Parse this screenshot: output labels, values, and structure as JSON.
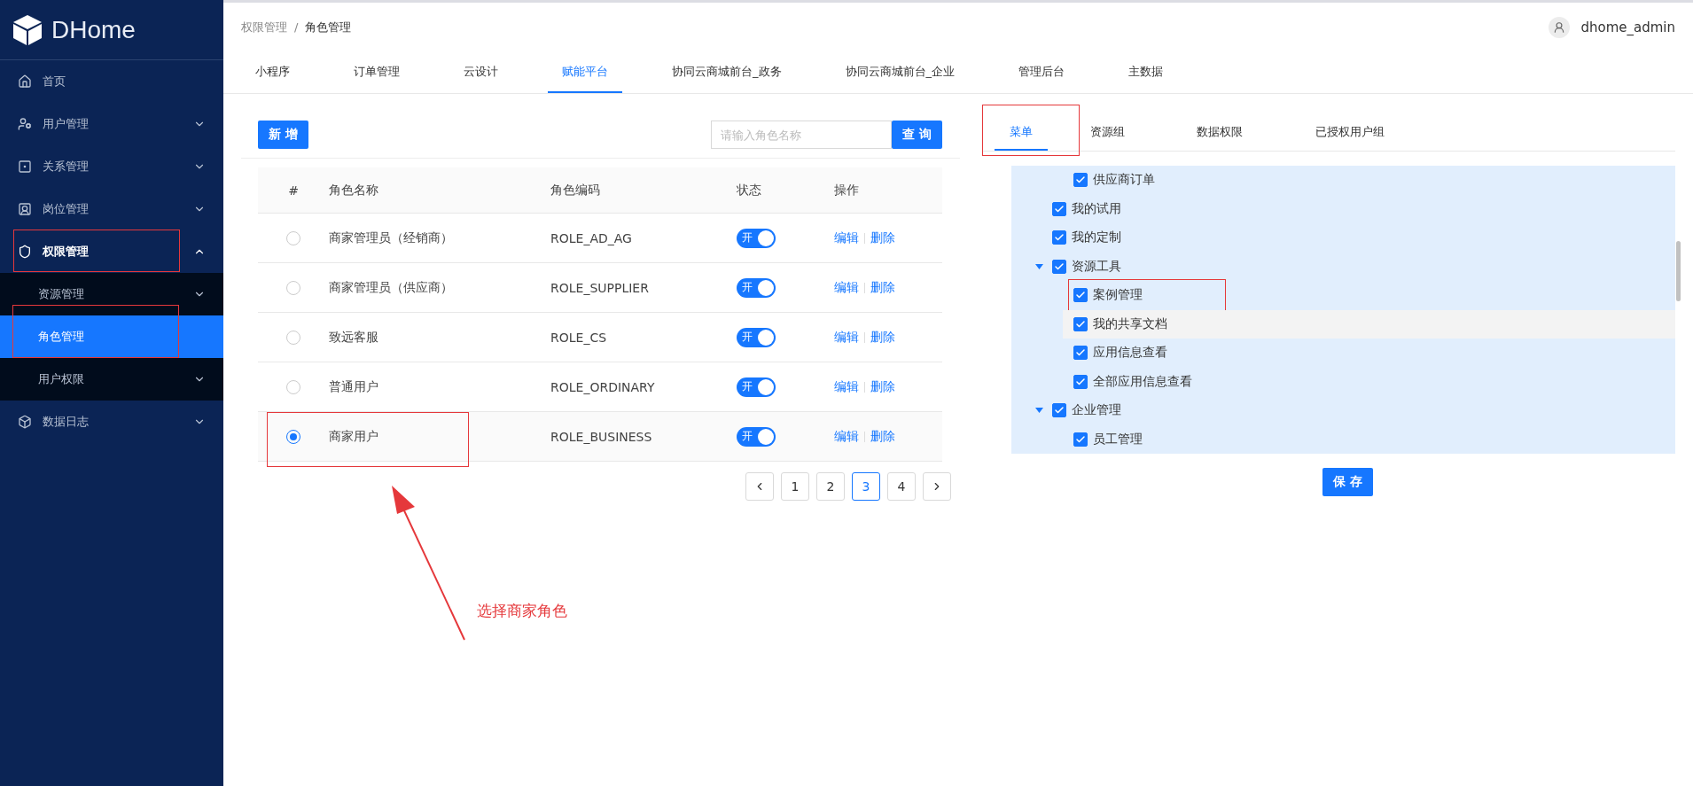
{
  "logo": {
    "text": "DHome"
  },
  "sidebar": {
    "items": [
      {
        "kind": "link",
        "label": "首页",
        "selected": false
      },
      {
        "kind": "group",
        "label": "用户管理",
        "expanded": false,
        "selected": false
      },
      {
        "kind": "group",
        "label": "关系管理",
        "expanded": false,
        "selected": false
      },
      {
        "kind": "group",
        "label": "岗位管理",
        "expanded": false,
        "selected": false
      },
      {
        "kind": "group",
        "label": "权限管理",
        "expanded": true,
        "selected": false,
        "annotated": true,
        "children": [
          {
            "kind": "group",
            "label": "资源管理",
            "expanded": false,
            "selected": false
          },
          {
            "kind": "link",
            "label": "角色管理",
            "selected": true,
            "annotated": true
          },
          {
            "kind": "group",
            "label": "用户权限",
            "expanded": false,
            "selected": false
          }
        ]
      },
      {
        "kind": "group",
        "label": "数据日志",
        "expanded": false,
        "selected": false
      }
    ]
  },
  "breadcrumb": [
    "权限管理",
    "角色管理"
  ],
  "breadcrumb_separator": "/",
  "user": {
    "name": "dhome_admin"
  },
  "top_tabs": [
    {
      "label": "小程序",
      "selected": false
    },
    {
      "label": "订单管理",
      "selected": false
    },
    {
      "label": "云设计",
      "selected": false
    },
    {
      "label": "赋能平台",
      "selected": true
    },
    {
      "label": "协同云商城前台_政务",
      "selected": false
    },
    {
      "label": "协同云商城前台_企业",
      "selected": false
    },
    {
      "label": "管理后台",
      "selected": false
    },
    {
      "label": "主数据",
      "selected": false
    }
  ],
  "toolbar": {
    "add_button": "新 增",
    "search": {
      "placeholder": "请输入角色名称"
    },
    "search_button": "查 询"
  },
  "table": {
    "columns": [
      "#",
      "角色名称",
      "角色编码",
      "状态",
      "操作"
    ],
    "rows": [
      {
        "selected": false,
        "name": "商家管理员（经销商）",
        "code": "ROLE_AD_AG",
        "status": {
          "on": true,
          "label": "开"
        },
        "actions": [
          "编辑",
          "删除"
        ]
      },
      {
        "selected": false,
        "name": "商家管理员（供应商）",
        "code": "ROLE_SUPPLIER",
        "status": {
          "on": true,
          "label": "开"
        },
        "actions": [
          "编辑",
          "删除"
        ]
      },
      {
        "selected": false,
        "name": "致远客服",
        "code": "ROLE_CS",
        "status": {
          "on": true,
          "label": "开"
        },
        "actions": [
          "编辑",
          "删除"
        ]
      },
      {
        "selected": false,
        "name": "普通用户",
        "code": "ROLE_ORDINARY",
        "status": {
          "on": true,
          "label": "开"
        },
        "actions": [
          "编辑",
          "删除"
        ]
      },
      {
        "selected": true,
        "annotated": true,
        "name": "商家用户",
        "code": "ROLE_BUSINESS",
        "status": {
          "on": true,
          "label": "开"
        },
        "actions": [
          "编辑",
          "删除"
        ]
      }
    ]
  },
  "pagination": {
    "pages": [
      {
        "label": "1",
        "selected": false
      },
      {
        "label": "2",
        "selected": false
      },
      {
        "label": "3",
        "selected": true
      },
      {
        "label": "4",
        "selected": false
      }
    ]
  },
  "annotation": {
    "text": "选择商家角色"
  },
  "right_tabs": [
    {
      "label": "菜单",
      "selected": true,
      "annotated": true
    },
    {
      "label": "资源组",
      "selected": false
    },
    {
      "label": "数据权限",
      "selected": false
    },
    {
      "label": "已授权用户组",
      "selected": false
    }
  ],
  "tree": [
    {
      "kind": "continued",
      "children": [
        {
          "kind": "leaf",
          "label": "供应商订单",
          "checked": true
        }
      ]
    },
    {
      "kind": "leaf",
      "label": "我的试用",
      "checked": true
    },
    {
      "kind": "leaf",
      "label": "我的定制",
      "checked": true
    },
    {
      "kind": "group",
      "label": "资源工具",
      "checked": true,
      "expanded": true,
      "children": [
        {
          "kind": "leaf",
          "label": "案例管理",
          "checked": true,
          "annotated": true
        },
        {
          "kind": "leaf",
          "label": "我的共享文档",
          "checked": true,
          "hovered": true
        },
        {
          "kind": "leaf",
          "label": "应用信息查看",
          "checked": true
        },
        {
          "kind": "leaf",
          "label": "全部应用信息查看",
          "checked": true
        }
      ]
    },
    {
      "kind": "group",
      "label": "企业管理",
      "checked": true,
      "expanded": true,
      "children": [
        {
          "kind": "leaf",
          "label": "员工管理",
          "checked": true
        }
      ]
    }
  ],
  "save_button": "保 存"
}
